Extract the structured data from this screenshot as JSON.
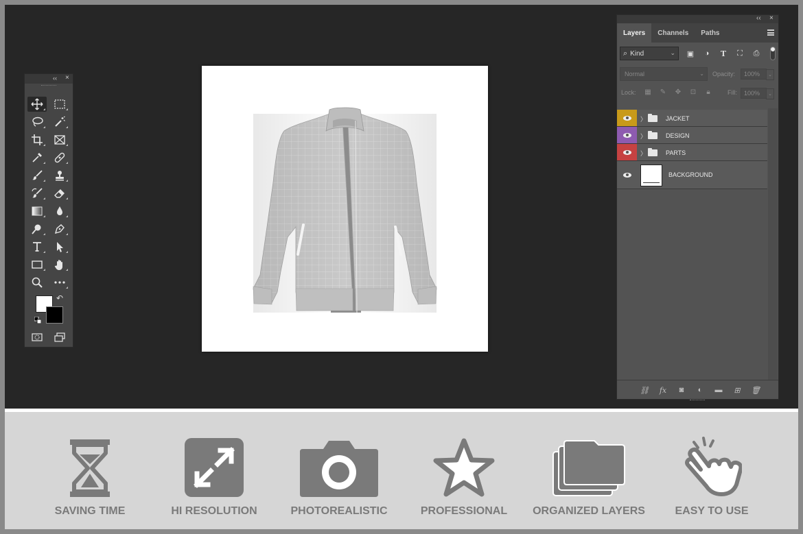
{
  "toolbox": {
    "collapse_label": "‹‹",
    "close_label": "×"
  },
  "layers_panel": {
    "collapse_label": "‹‹",
    "close_label": "×",
    "tabs": [
      {
        "label": "Layers",
        "active": true
      },
      {
        "label": "Channels",
        "active": false
      },
      {
        "label": "Paths",
        "active": false
      }
    ],
    "filter_kind": "Kind",
    "blend_mode": "Normal",
    "opacity_label": "Opacity:",
    "opacity_value": "100%",
    "lock_label": "Lock:",
    "fill_label": "Fill:",
    "fill_value": "100%",
    "layers": [
      {
        "name": "JACKET",
        "type": "group",
        "color": "#c89a1a"
      },
      {
        "name": "DESIGN",
        "type": "group",
        "color": "#8e5bb0"
      },
      {
        "name": "PARTS",
        "type": "group",
        "color": "#c64242"
      },
      {
        "name": "BACKGROUND",
        "type": "image",
        "color": ""
      }
    ]
  },
  "features": [
    {
      "label": "SAVING TIME",
      "icon": "hourglass-icon"
    },
    {
      "label": "HI RESOLUTION",
      "icon": "expand-arrows-icon"
    },
    {
      "label": "PHOTOREALISTIC",
      "icon": "camera-icon"
    },
    {
      "label": "PROFESSIONAL",
      "icon": "star-icon"
    },
    {
      "label": "ORGANIZED LAYERS",
      "icon": "stacked-layers-icon"
    },
    {
      "label": "EASY TO USE",
      "icon": "tap-hand-icon"
    }
  ],
  "colors": {
    "workspace_bg": "#262626",
    "panel_bg": "#535353",
    "feature_bar_bg": "#d6d6d6",
    "feature_icon": "#7a7a7a"
  }
}
